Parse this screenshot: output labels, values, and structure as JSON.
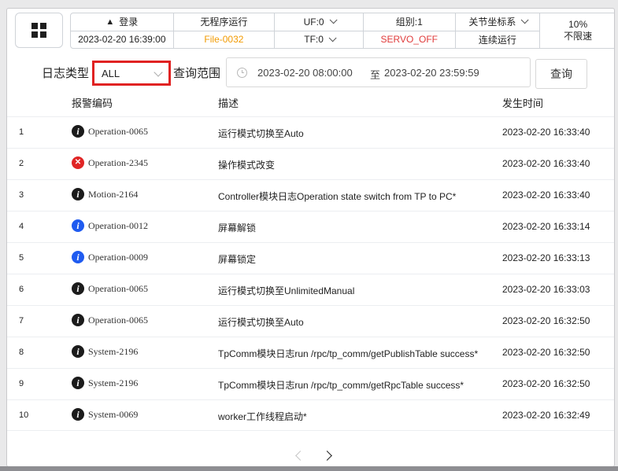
{
  "header": {
    "login": "登录",
    "datetime": "2023-02-20 16:39:00",
    "program_status": "无程序运行",
    "file": "File-0032",
    "uf": "UF:0",
    "tf": "TF:0",
    "group": "组别:1",
    "servo": "SERVO_OFF",
    "coord_system": "关节坐标系",
    "run_mode": "连续运行",
    "speed_percent": "10%",
    "speed_mode": "不限速"
  },
  "filter": {
    "log_type_label": "日志类型",
    "log_type_value": "ALL",
    "range_label": "查询范围",
    "range_start": "2023-02-20 08:00:00",
    "range_sep": "至",
    "range_end": "2023-02-20 23:59:59",
    "query_button": "查询"
  },
  "table": {
    "columns": [
      "报警编码",
      "描述",
      "发生时间"
    ],
    "rows": [
      {
        "idx": "1",
        "icon": "info-dark",
        "code": "Operation-0065",
        "desc": "运行模式切换至Auto",
        "time": "2023-02-20 16:33:40"
      },
      {
        "idx": "2",
        "icon": "err",
        "code": "Operation-2345",
        "desc": "操作模式改变",
        "time": "2023-02-20 16:33:40"
      },
      {
        "idx": "3",
        "icon": "info-dark",
        "code": "Motion-2164",
        "desc": "Controller模块日志Operation state switch from TP to PC*",
        "time": "2023-02-20 16:33:40"
      },
      {
        "idx": "4",
        "icon": "info-blue",
        "code": "Operation-0012",
        "desc": "屏幕解锁",
        "time": "2023-02-20 16:33:14"
      },
      {
        "idx": "5",
        "icon": "info-blue",
        "code": "Operation-0009",
        "desc": "屏幕锁定",
        "time": "2023-02-20 16:33:13"
      },
      {
        "idx": "6",
        "icon": "info-dark",
        "code": "Operation-0065",
        "desc": "运行模式切换至UnlimitedManual",
        "time": "2023-02-20 16:33:03"
      },
      {
        "idx": "7",
        "icon": "info-dark",
        "code": "Operation-0065",
        "desc": "运行模式切换至Auto",
        "time": "2023-02-20 16:32:50"
      },
      {
        "idx": "8",
        "icon": "info-dark",
        "code": "System-2196",
        "desc": "TpComm模块日志run /rpc/tp_comm/getPublishTable success*",
        "time": "2023-02-20 16:32:50"
      },
      {
        "idx": "9",
        "icon": "info-dark",
        "code": "System-2196",
        "desc": "TpComm模块日志run /rpc/tp_comm/getRpcTable success*",
        "time": "2023-02-20 16:32:50"
      },
      {
        "idx": "10",
        "icon": "info-dark",
        "code": "System-0069",
        "desc": "worker工作线程启动*",
        "time": "2023-02-20 16:32:49"
      }
    ]
  },
  "colors": {
    "file_orange": "#f29a00",
    "servo_red": "#e03b3b",
    "highlight_red": "#e02222",
    "info_blue": "#1f5bf0",
    "error_red": "#e02525"
  }
}
